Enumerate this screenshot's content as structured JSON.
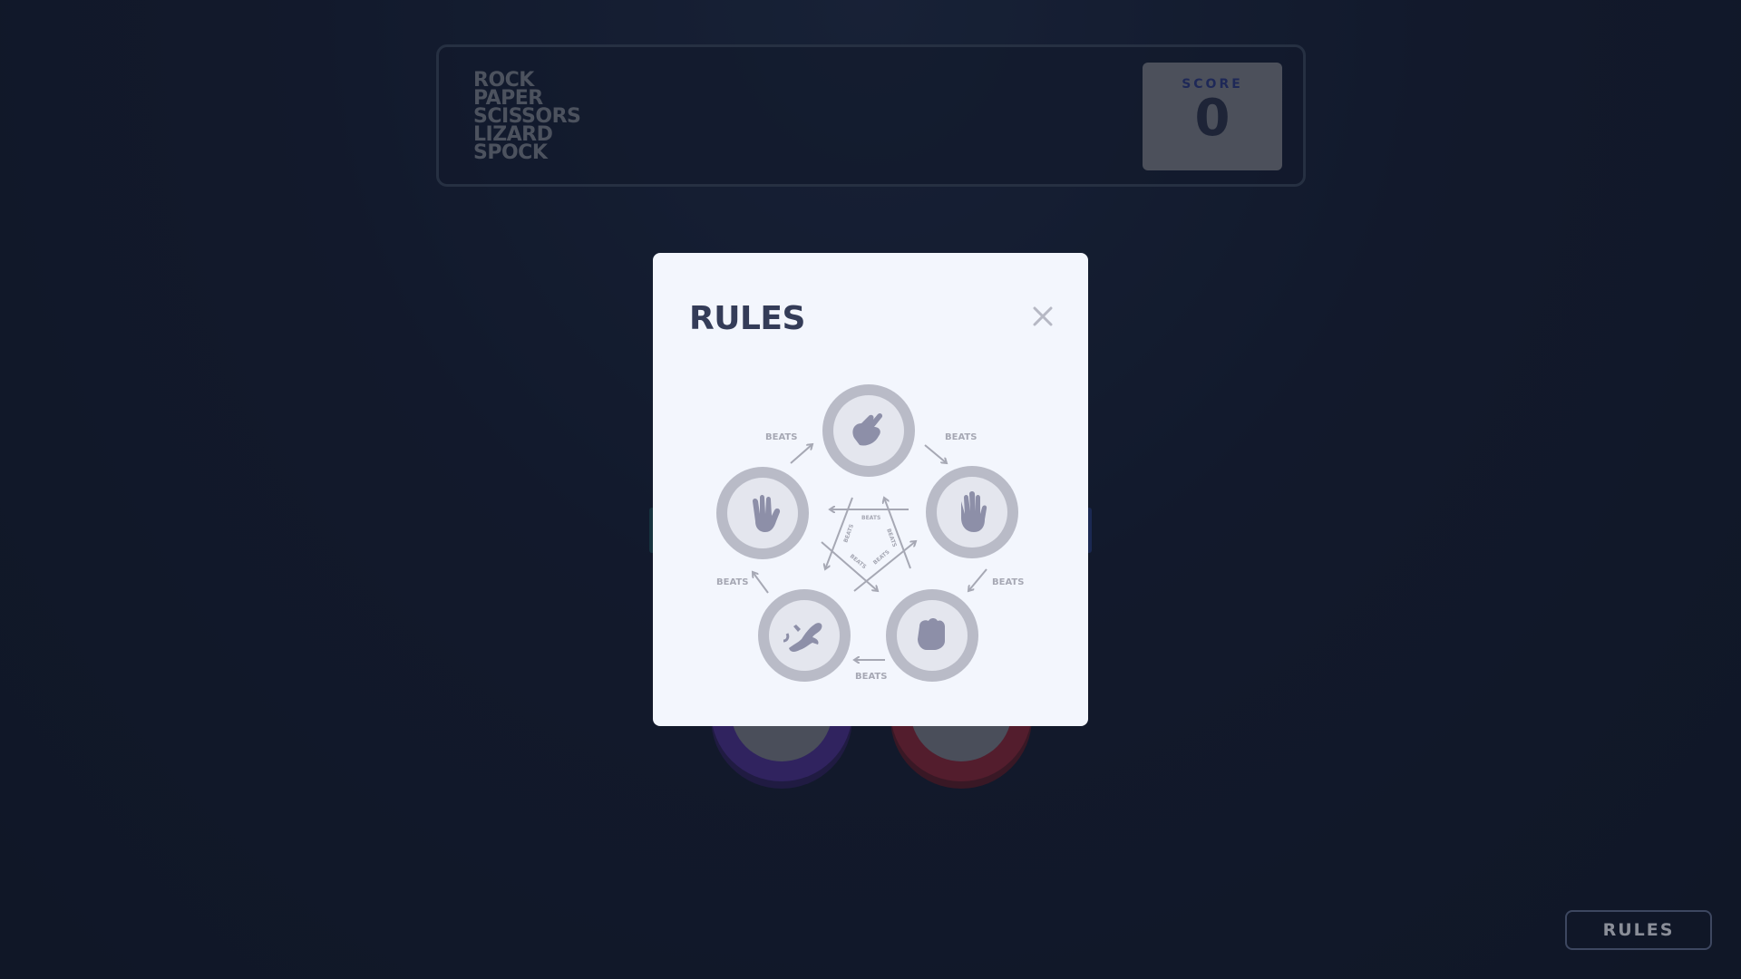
{
  "header": {
    "logo_lines": [
      "ROCK",
      "PAPER",
      "SCISSORS",
      "LIZARD",
      "SPOCK"
    ],
    "score_label": "SCORE",
    "score_value": "0"
  },
  "footer": {
    "rules_button_label": "RULES"
  },
  "modal": {
    "title": "RULES",
    "close_icon": "close-icon",
    "beats_labels": [
      "BEATS",
      "BEATS",
      "BEATS",
      "BEATS",
      "BEATS"
    ],
    "inner_beats_labels": [
      "BEATS",
      "BEATS",
      "BEATS",
      "BEATS",
      "BEATS"
    ],
    "tokens": [
      {
        "name": "scissors",
        "icon": "scissors-icon"
      },
      {
        "name": "paper",
        "icon": "paper-icon"
      },
      {
        "name": "rock",
        "icon": "rock-icon"
      },
      {
        "name": "lizard",
        "icon": "lizard-icon"
      },
      {
        "name": "spock",
        "icon": "spock-icon"
      }
    ]
  },
  "colors": {
    "background": "#141d32",
    "modal_bg": "#f3f6fd",
    "title": "#343c58",
    "token_ring": "#b9bbc7",
    "token_icon": "#8d8fa8",
    "purple_token": "#4b2f8f",
    "red_token": "#8a2334"
  }
}
